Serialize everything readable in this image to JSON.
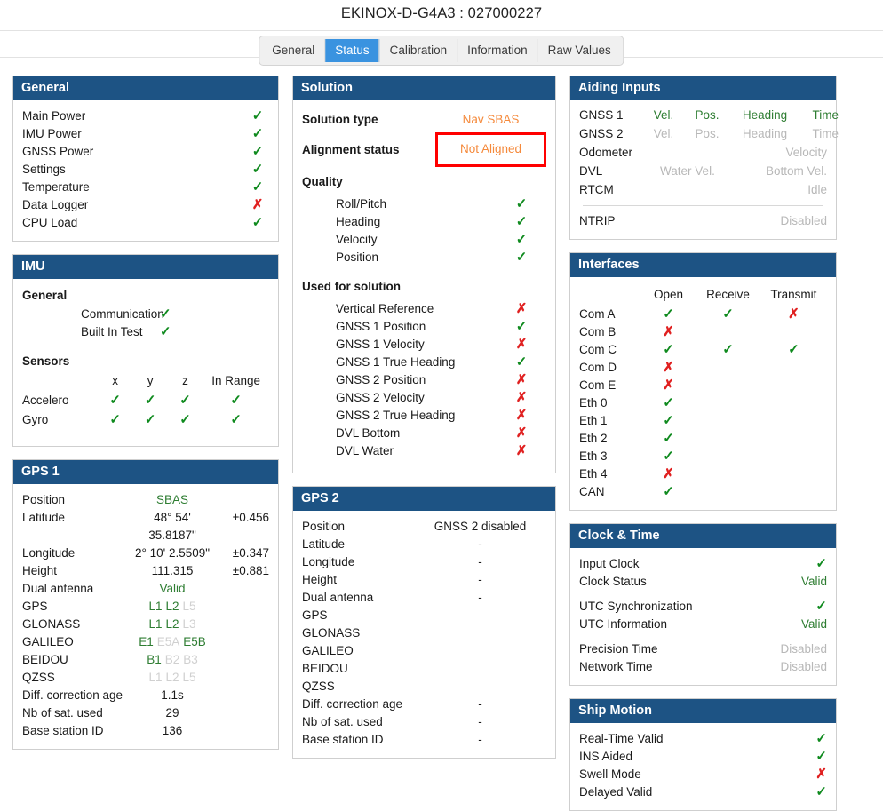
{
  "header": {
    "title": "EKINOX-D-G4A3 : 027000227"
  },
  "tabs": [
    {
      "label": "General",
      "active": false
    },
    {
      "label": "Status",
      "active": true
    },
    {
      "label": "Calibration",
      "active": false
    },
    {
      "label": "Information",
      "active": false
    },
    {
      "label": "Raw Values",
      "active": false
    }
  ],
  "colors": {
    "panel_header": "#1d5384",
    "tab_active": "#3a93e0",
    "ok_green": "#0f8a1e",
    "fail_red": "#e02020",
    "alert_border": "#ff0000",
    "orange": "#f58a3c",
    "value_green": "#2e7d32",
    "disabled_grey": "#b8b8b8"
  },
  "general_panel": {
    "title": "General",
    "items": [
      {
        "label": "Main Power",
        "status": "ok"
      },
      {
        "label": "IMU Power",
        "status": "ok"
      },
      {
        "label": "GNSS Power",
        "status": "ok"
      },
      {
        "label": "Settings",
        "status": "ok"
      },
      {
        "label": "Temperature",
        "status": "ok"
      },
      {
        "label": "Data Logger",
        "status": "fail"
      },
      {
        "label": "CPU Load",
        "status": "ok"
      }
    ]
  },
  "imu_panel": {
    "title": "IMU",
    "general_heading": "General",
    "general_items": [
      {
        "label": "Communication",
        "status": "ok"
      },
      {
        "label": "Built In Test",
        "status": "ok"
      }
    ],
    "sensors_heading": "Sensors",
    "sensor_columns": [
      "x",
      "y",
      "z",
      "In Range"
    ],
    "sensor_rows": [
      {
        "name": "Accelero",
        "x": "ok",
        "y": "ok",
        "z": "ok",
        "in_range": "ok"
      },
      {
        "name": "Gyro",
        "x": "ok",
        "y": "ok",
        "z": "ok",
        "in_range": "ok"
      }
    ]
  },
  "gps1_panel": {
    "title": "GPS 1",
    "position_label": "Position",
    "position_value": "SBAS",
    "latitude_label": "Latitude",
    "latitude_value": "48° 54' 35.8187\"",
    "latitude_error": "±0.456",
    "longitude_label": "Longitude",
    "longitude_value": "2° 10' 2.5509\"",
    "longitude_error": "±0.347",
    "height_label": "Height",
    "height_value": "111.315",
    "height_error": "±0.881",
    "dual_antenna_label": "Dual antenna",
    "dual_antenna_value": "Valid",
    "constellations": [
      {
        "name": "GPS",
        "bands": [
          {
            "t": "L1",
            "on": true
          },
          {
            "t": "L2",
            "on": true
          },
          {
            "t": "L5",
            "on": false
          }
        ]
      },
      {
        "name": "GLONASS",
        "bands": [
          {
            "t": "L1",
            "on": true
          },
          {
            "t": "L2",
            "on": true
          },
          {
            "t": "L3",
            "on": false
          }
        ]
      },
      {
        "name": "GALILEO",
        "bands": [
          {
            "t": "E1",
            "on": true
          },
          {
            "t": "E5A",
            "on": false
          },
          {
            "t": "E5B",
            "on": true
          }
        ]
      },
      {
        "name": "BEIDOU",
        "bands": [
          {
            "t": "B1",
            "on": true
          },
          {
            "t": "B2",
            "on": false
          },
          {
            "t": "B3",
            "on": false
          }
        ]
      },
      {
        "name": "QZSS",
        "bands": [
          {
            "t": "L1",
            "on": false
          },
          {
            "t": "L2",
            "on": false
          },
          {
            "t": "L5",
            "on": false
          }
        ]
      }
    ],
    "diff_age_label": "Diff. correction age",
    "diff_age_value": "1.1s",
    "nb_sat_label": "Nb of sat. used",
    "nb_sat_value": "29",
    "base_station_label": "Base station ID",
    "base_station_value": "136"
  },
  "solution_panel": {
    "title": "Solution",
    "solution_type_label": "Solution type",
    "solution_type_value": "Nav SBAS",
    "alignment_label": "Alignment status",
    "alignment_value": "Not Aligned",
    "quality_heading": "Quality",
    "quality_items": [
      {
        "label": "Roll/Pitch",
        "status": "ok"
      },
      {
        "label": "Heading",
        "status": "ok"
      },
      {
        "label": "Velocity",
        "status": "ok"
      },
      {
        "label": "Position",
        "status": "ok"
      }
    ],
    "used_heading": "Used for solution",
    "used_items": [
      {
        "label": "Vertical Reference",
        "status": "fail"
      },
      {
        "label": "GNSS 1 Position",
        "status": "ok"
      },
      {
        "label": "GNSS 1 Velocity",
        "status": "fail"
      },
      {
        "label": "GNSS 1 True Heading",
        "status": "ok"
      },
      {
        "label": "GNSS 2 Position",
        "status": "fail"
      },
      {
        "label": "GNSS 2 Velocity",
        "status": "fail"
      },
      {
        "label": "GNSS 2 True Heading",
        "status": "fail"
      },
      {
        "label": "DVL Bottom",
        "status": "fail"
      },
      {
        "label": "DVL Water",
        "status": "fail"
      }
    ]
  },
  "gps2_panel": {
    "title": "GPS 2",
    "rows": [
      {
        "label": "Position",
        "value": "GNSS 2 disabled"
      },
      {
        "label": "Latitude",
        "value": "-"
      },
      {
        "label": "Longitude",
        "value": "-"
      },
      {
        "label": "Height",
        "value": "-"
      },
      {
        "label": "Dual antenna",
        "value": "-"
      },
      {
        "label": "GPS",
        "value": ""
      },
      {
        "label": "GLONASS",
        "value": ""
      },
      {
        "label": "GALILEO",
        "value": ""
      },
      {
        "label": "BEIDOU",
        "value": ""
      },
      {
        "label": "QZSS",
        "value": ""
      },
      {
        "label": "Diff. correction age",
        "value": "-"
      },
      {
        "label": "Nb of sat. used",
        "value": "-"
      },
      {
        "label": "Base station ID",
        "value": "-"
      }
    ]
  },
  "aiding_panel": {
    "title": "Aiding Inputs",
    "gnss1": {
      "name": "GNSS 1",
      "vel": "Vel.",
      "pos": "Pos.",
      "heading": "Heading",
      "time": "Time",
      "active": true
    },
    "gnss2": {
      "name": "GNSS 2",
      "vel": "Vel.",
      "pos": "Pos.",
      "heading": "Heading",
      "time": "Time",
      "active": false
    },
    "odometer": {
      "name": "Odometer",
      "value": "Velocity"
    },
    "dvl": {
      "name": "DVL",
      "water": "Water Vel.",
      "bottom": "Bottom Vel."
    },
    "rtcm": {
      "name": "RTCM",
      "value": "Idle"
    },
    "ntrip": {
      "name": "NTRIP",
      "value": "Disabled"
    }
  },
  "interfaces_panel": {
    "title": "Interfaces",
    "columns": [
      "Open",
      "Receive",
      "Transmit"
    ],
    "rows": [
      {
        "name": "Com A",
        "open": "ok",
        "receive": "ok",
        "transmit": "fail"
      },
      {
        "name": "Com B",
        "open": "fail",
        "receive": "",
        "transmit": ""
      },
      {
        "name": "Com C",
        "open": "ok",
        "receive": "ok",
        "transmit": "ok"
      },
      {
        "name": "Com D",
        "open": "fail",
        "receive": "",
        "transmit": ""
      },
      {
        "name": "Com E",
        "open": "fail",
        "receive": "",
        "transmit": ""
      },
      {
        "name": "Eth 0",
        "open": "ok",
        "receive": "",
        "transmit": ""
      },
      {
        "name": "Eth 1",
        "open": "ok",
        "receive": "",
        "transmit": ""
      },
      {
        "name": "Eth 2",
        "open": "ok",
        "receive": "",
        "transmit": ""
      },
      {
        "name": "Eth 3",
        "open": "ok",
        "receive": "",
        "transmit": ""
      },
      {
        "name": "Eth 4",
        "open": "fail",
        "receive": "",
        "transmit": ""
      },
      {
        "name": "CAN",
        "open": "ok",
        "receive": "",
        "transmit": ""
      }
    ]
  },
  "clock_panel": {
    "title": "Clock & Time",
    "input_clock_label": "Input Clock",
    "input_clock_status": "ok",
    "clock_status_label": "Clock Status",
    "clock_status_value": "Valid",
    "utc_sync_label": "UTC Synchronization",
    "utc_sync_status": "ok",
    "utc_info_label": "UTC Information",
    "utc_info_value": "Valid",
    "precision_time_label": "Precision Time",
    "precision_time_value": "Disabled",
    "network_time_label": "Network Time",
    "network_time_value": "Disabled"
  },
  "ship_motion_panel": {
    "title": "Ship Motion",
    "items": [
      {
        "label": "Real-Time Valid",
        "status": "ok"
      },
      {
        "label": "INS Aided",
        "status": "ok"
      },
      {
        "label": "Swell Mode",
        "status": "fail"
      },
      {
        "label": "Delayed Valid",
        "status": "ok"
      }
    ]
  }
}
